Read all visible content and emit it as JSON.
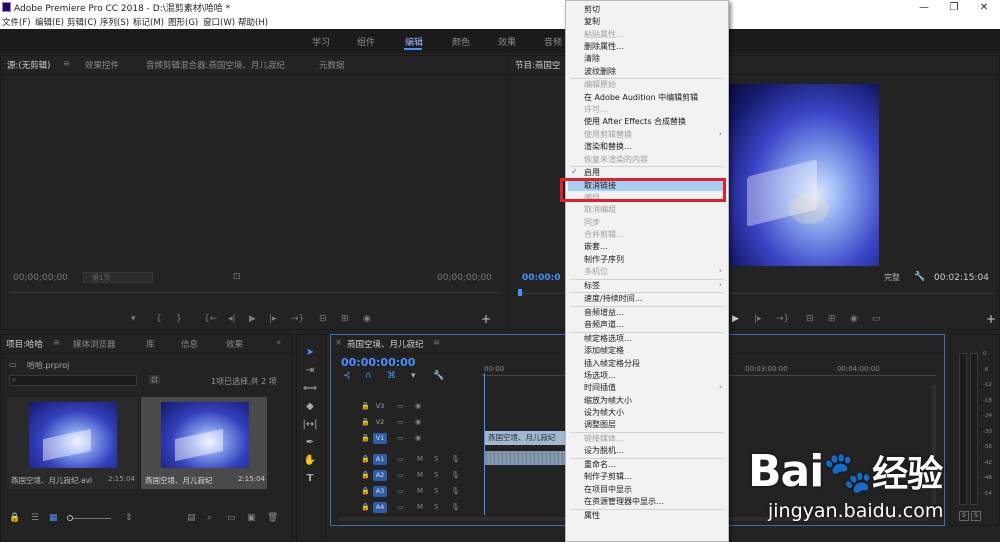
{
  "window": {
    "title": "Adobe Premiere Pro CC 2018 - D:\\混剪素材\\哈哈 *",
    "controls": [
      "—",
      "❐",
      "✕"
    ]
  },
  "menubar": [
    "文件(F)",
    "编辑(E)",
    "剪辑(C)",
    "序列(S)",
    "标记(M)",
    "图形(G)",
    "窗口(W)",
    "帮助(H)"
  ],
  "workspaces": {
    "items": [
      "学习",
      "组件",
      "编辑",
      "颜色",
      "效果",
      "音频"
    ],
    "active": "编辑"
  },
  "source_panel": {
    "tabs": [
      "源:(无剪辑)",
      "效果控件",
      "音频剪辑混合器:燕国空境、月儿寂纪",
      "元数据"
    ],
    "timecode_left": "00;00;00;00",
    "timecode_right": "00;00;00;00",
    "page_label": "第1页"
  },
  "program_panel": {
    "tab": "节目:燕国空",
    "timecode": "00:00:0",
    "quality": "完整",
    "duration": "00:02:15:04"
  },
  "project_panel": {
    "tabs": [
      "项目:哈哈",
      "媒体浏览器",
      "库",
      "信息",
      "效果"
    ],
    "project_file": "哈哈.prproj",
    "selection_info": "1项已选择,共 2 项",
    "items": [
      {
        "name": "燕国空境、月儿寂纪.avi",
        "duration": "2:15:04"
      },
      {
        "name": "燕国空境、月儿寂纪",
        "duration": "2:15:04"
      }
    ]
  },
  "timeline": {
    "tab": "燕国空境、月儿寂纪",
    "timecode": "00:00:00:00",
    "ruler": [
      "00:00",
      "00:03:00:00",
      "00:04:00:00"
    ],
    "video_tracks": [
      "V3",
      "V2",
      "V1"
    ],
    "audio_tracks": [
      "A1",
      "A2",
      "A3",
      "A4"
    ],
    "clip_label": "燕国空境、月儿寂纪",
    "track_m": "M",
    "track_s": "S"
  },
  "audio_meter": {
    "scale": [
      "0",
      "-6",
      "-12",
      "-18",
      "-24",
      "-30",
      "-36",
      "-42",
      "-48",
      "-54"
    ],
    "solo": [
      "S",
      "S"
    ]
  },
  "context_menu": {
    "highlighted": "取消链接",
    "checked_item": "启用",
    "items": [
      {
        "label": "剪切",
        "disabled": false
      },
      {
        "label": "复制",
        "disabled": false
      },
      {
        "label": "粘贴属性...",
        "disabled": true
      },
      {
        "label": "删除属性...",
        "disabled": false
      },
      {
        "label": "清除",
        "disabled": false
      },
      {
        "label": "波纹删除",
        "disabled": false
      },
      {
        "sep": true
      },
      {
        "label": "编辑原始",
        "disabled": true
      },
      {
        "label": "在 Adobe Audition 中编辑剪辑",
        "disabled": false
      },
      {
        "label": "许可...",
        "disabled": true
      },
      {
        "label": "使用 After Effects 合成替换",
        "disabled": false
      },
      {
        "label": "使用剪辑替换",
        "disabled": true,
        "submenu": true
      },
      {
        "label": "渲染和替换...",
        "disabled": false
      },
      {
        "label": "恢复未渲染的内容",
        "disabled": true
      },
      {
        "sep": true
      },
      {
        "label": "启用",
        "disabled": false,
        "checked": true
      },
      {
        "label": "取消链接",
        "disabled": false,
        "highlight": true
      },
      {
        "label": "编组",
        "disabled": true
      },
      {
        "label": "取消编组",
        "disabled": true
      },
      {
        "label": "同步",
        "disabled": true
      },
      {
        "label": "合并剪辑...",
        "disabled": true
      },
      {
        "label": "嵌套...",
        "disabled": false
      },
      {
        "label": "制作子序列",
        "disabled": false
      },
      {
        "label": "多机位",
        "disabled": true,
        "submenu": true
      },
      {
        "sep": true
      },
      {
        "label": "标签",
        "disabled": false,
        "submenu": true
      },
      {
        "sep": true
      },
      {
        "label": "速度/持续时间...",
        "disabled": false
      },
      {
        "sep": true
      },
      {
        "label": "音频增益...",
        "disabled": false
      },
      {
        "label": "音频声道...",
        "disabled": false
      },
      {
        "sep": true
      },
      {
        "label": "帧定格选项...",
        "disabled": false
      },
      {
        "label": "添加帧定格",
        "disabled": false
      },
      {
        "label": "插入帧定格分段",
        "disabled": false
      },
      {
        "label": "场选项...",
        "disabled": false
      },
      {
        "label": "时间插值",
        "disabled": false,
        "submenu": true
      },
      {
        "label": "缩放为帧大小",
        "disabled": false
      },
      {
        "label": "设为帧大小",
        "disabled": false
      },
      {
        "label": "调整图层",
        "disabled": false
      },
      {
        "sep": true
      },
      {
        "label": "链接媒体...",
        "disabled": true
      },
      {
        "label": "设为脱机...",
        "disabled": false
      },
      {
        "sep": true
      },
      {
        "label": "重命名...",
        "disabled": false
      },
      {
        "label": "制作子剪辑...",
        "disabled": false
      },
      {
        "label": "在项目中显示",
        "disabled": false
      },
      {
        "label": "在资源管理器中显示...",
        "disabled": false
      },
      {
        "sep": true
      },
      {
        "label": "属性",
        "disabled": false
      }
    ]
  },
  "watermark": {
    "brand_a": "Bai",
    "brand_b": "经验",
    "url": "jingyan.baidu.com"
  },
  "colors": {
    "accent": "#4a8fff",
    "highlight": "#a8cdf3",
    "annotation_red": "#e0202b"
  }
}
